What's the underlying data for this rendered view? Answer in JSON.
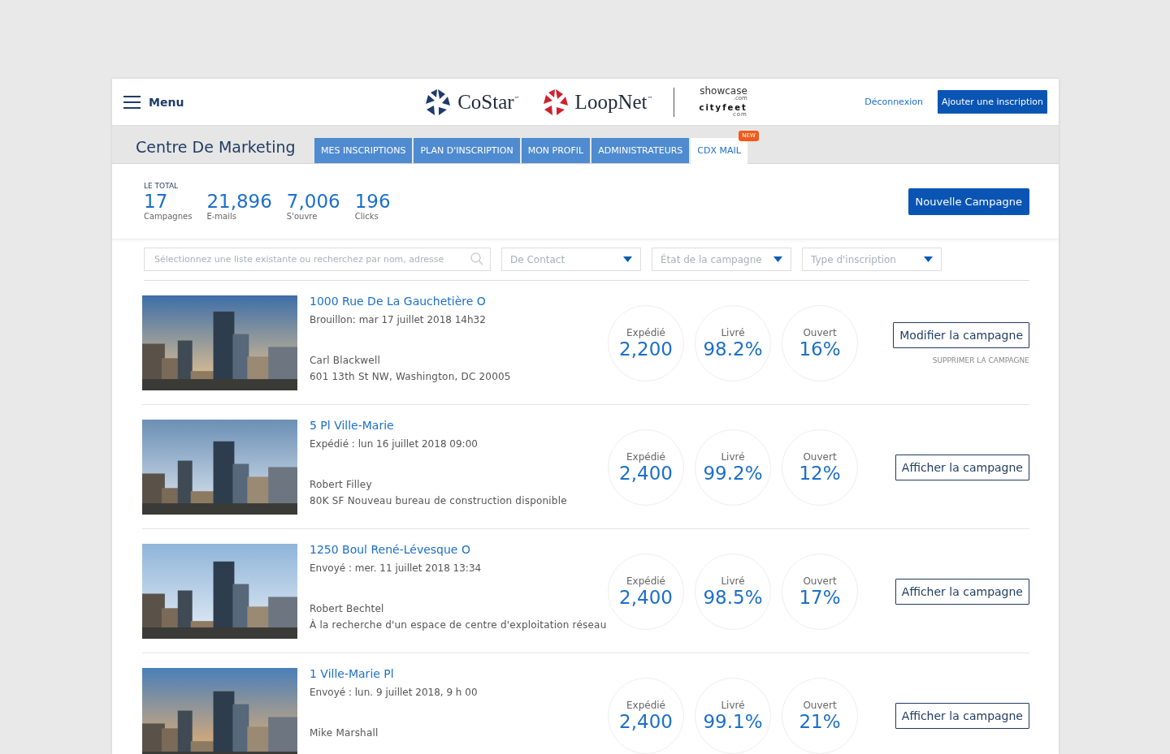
{
  "header": {
    "menu_label": "Menu",
    "logos": [
      {
        "kind": "costar",
        "name": "CoStar",
        "mark": "™"
      },
      {
        "kind": "loopnet",
        "name": "LoopNet",
        "mark": "™"
      },
      {
        "kind": "showcase",
        "name": "showcase",
        "sub": ".com",
        "name2": "cityfeet",
        "sub2": "com"
      }
    ],
    "logout": "Déconnexion",
    "add_button": "Ajouter une inscription"
  },
  "title": "Centre De Marketing",
  "tabs": [
    {
      "label": "MES INSCRIPTIONS",
      "selected": false
    },
    {
      "label": "PLAN D'INSCRIPTION",
      "selected": false
    },
    {
      "label": "MON PROFIL",
      "selected": false
    },
    {
      "label": "ADMINISTRATEURS",
      "selected": false
    },
    {
      "label": "CDX MAIL",
      "selected": true,
      "badge": "NEW"
    }
  ],
  "totals": {
    "label": "LE TOTAL",
    "items": [
      {
        "value": "17",
        "label": "Campagnes"
      },
      {
        "value": "21,896",
        "label": "E-mails"
      },
      {
        "value": "7,006",
        "label": "S'ouvre"
      },
      {
        "value": "196",
        "label": "Clicks"
      }
    ]
  },
  "new_campaign_button": "Nouvelle Campagne",
  "filters": {
    "search_placeholder": "Sélectionnez une liste existante ou recherchez par nom, adresse",
    "dropdowns": [
      "De Contact",
      "État de la campagne",
      "Type d'inscription"
    ]
  },
  "campaigns": [
    {
      "title": "1000 Rue De La Gauchetière O",
      "status": "Brouillon: mar 17 juillet 2018 14h32",
      "contact": "Carl Blackwell",
      "detail": "601 13th St NW, Washington, DC 20005",
      "stats": [
        {
          "label": "Expédié",
          "value": "2,200"
        },
        {
          "label": "Livré",
          "value": "98.2%"
        },
        {
          "label": "Ouvert",
          "value": "16%"
        }
      ],
      "action": "Modifier la campagne",
      "delete": "SUPPRIMER LA CAMPAGNE"
    },
    {
      "title": "5 Pl Ville-Marie",
      "status": "Expédié : lun 16 juillet 2018 09:00",
      "contact": "Robert Filley",
      "detail": "80K SF Nouveau bureau de construction disponible",
      "stats": [
        {
          "label": "Expédié",
          "value": "2,400"
        },
        {
          "label": "Livré",
          "value": "99.2%"
        },
        {
          "label": "Ouvert",
          "value": "12%"
        }
      ],
      "action": "Afficher la campagne"
    },
    {
      "title": "1250 Boul René-Lévesque O",
      "status": "Envoyé : mer. 11 juillet 2018 13:34",
      "contact": "Robert Bechtel",
      "detail": "À la recherche d'un espace de centre d'exploitation réseau",
      "stats": [
        {
          "label": "Expédié",
          "value": "2,400"
        },
        {
          "label": "Livré",
          "value": "98.5%"
        },
        {
          "label": "Ouvert",
          "value": "17%"
        }
      ],
      "action": "Afficher la campagne"
    },
    {
      "title": "1 Ville-Marie Pl",
      "status": "Envoyé : lun. 9 juillet 2018, 9 h 00",
      "contact": "Mike Marshall",
      "stats": [
        {
          "label": "Expédié",
          "value": "2,400"
        },
        {
          "label": "Livré",
          "value": "99.1%"
        },
        {
          "label": "Ouvert",
          "value": "21%"
        }
      ],
      "action": "Afficher la campagne"
    }
  ]
}
